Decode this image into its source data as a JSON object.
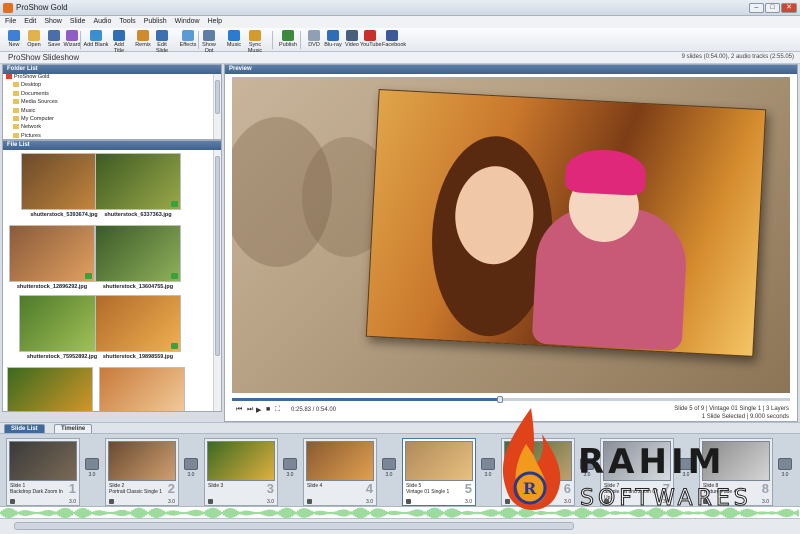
{
  "window": {
    "title": "ProShow Gold",
    "min": "–",
    "max": "□",
    "close": "✕"
  },
  "menu": [
    "File",
    "Edit",
    "Show",
    "Slide",
    "Audio",
    "Tools",
    "Publish",
    "Window",
    "Help"
  ],
  "toolbar": [
    {
      "label": "New",
      "icon": "new-icon",
      "color": "#3c7fd6"
    },
    {
      "label": "Open",
      "icon": "open-folder-icon",
      "color": "#e2b24a"
    },
    {
      "label": "Save",
      "icon": "save-icon",
      "color": "#4a6fa8"
    },
    {
      "label": "Wizard",
      "icon": "wizard-icon",
      "color": "#8e5ec4"
    },
    {
      "label": "Add Blank",
      "icon": "add-blank-icon",
      "color": "#3a8fd0"
    },
    {
      "label": "Add Title",
      "icon": "add-title-icon",
      "color": "#2f6db5"
    },
    {
      "label": "Remix",
      "icon": "remix-icon",
      "color": "#d08a2a"
    },
    {
      "label": "Edit Slide",
      "icon": "edit-slide-icon",
      "color": "#3b6fb0"
    },
    {
      "label": "Effects",
      "icon": "effects-icon",
      "color": "#5a9ad6"
    },
    {
      "label": "Show Opt",
      "icon": "show-options-icon",
      "color": "#5f7ea5"
    },
    {
      "label": "Music",
      "icon": "music-icon",
      "color": "#2b7bd3"
    },
    {
      "label": "Sync Music",
      "icon": "sync-music-icon",
      "color": "#d59a2c"
    },
    {
      "label": "Publish",
      "icon": "publish-icon",
      "color": "#3d8a3d"
    },
    {
      "label": "DVD",
      "icon": "dvd-icon",
      "color": "#8fa0b5"
    },
    {
      "label": "Blu-ray",
      "icon": "blu-ray-icon",
      "color": "#2c6fb8"
    },
    {
      "label": "Video",
      "icon": "video-icon",
      "color": "#4a5f7a"
    },
    {
      "label": "YouTube",
      "icon": "youtube-icon",
      "color": "#c8302a"
    },
    {
      "label": "Facebook",
      "icon": "facebook-icon",
      "color": "#3b5998"
    }
  ],
  "appbar": {
    "title": "ProShow Slideshow",
    "status": "9 slides (0:54.00), 2 audio tracks (2:55.05)"
  },
  "folder_list": {
    "header": "Folder List",
    "items": [
      "ProShow Gold",
      "Desktop",
      "Documents",
      "Media Sources",
      "Music",
      "My Computer",
      "Network",
      "Pictures"
    ]
  },
  "file_list": {
    "header": "File List",
    "files": [
      {
        "name": "shutterstock_5393674.jpg",
        "colors": [
          "#6b4a2a",
          "#c98a3f"
        ]
      },
      {
        "name": "shutterstock_6337363.jpg",
        "colors": [
          "#3d5a22",
          "#9aa84a"
        ]
      },
      {
        "name": "shutterstock_12896292.jpg",
        "colors": [
          "#8a5a3a",
          "#e0a060"
        ]
      },
      {
        "name": "shutterstock_13604755.jpg",
        "colors": [
          "#3a5a28",
          "#8fb05a"
        ]
      },
      {
        "name": "shutterstock_75952892.jpg",
        "colors": [
          "#4e7a2a",
          "#a7c55a"
        ]
      },
      {
        "name": "shutterstock_19898559.jpg",
        "colors": [
          "#b06a2a",
          "#f0b050"
        ]
      },
      {
        "name": "",
        "colors": [
          "#3a6a1e",
          "#e09a2a"
        ]
      },
      {
        "name": "",
        "colors": [
          "#c87a3a",
          "#f5d0a0"
        ]
      }
    ]
  },
  "preview": {
    "header": "Preview",
    "progress": 0.48,
    "timecode": "0:25.83 / 0:54.00",
    "slide_info": "Slide 5 of 9  |  Vintage 01 Single 1  |  3 Layers",
    "slide_info2": "1 Slide Selected  |  9.000 seconds",
    "controls": [
      "⏮",
      "⏭",
      "▶",
      "■",
      "⛶"
    ]
  },
  "tabs": [
    "Slide List",
    "Timeline"
  ],
  "slides": [
    {
      "label": "Slide 1",
      "sub": "Backdrop Dark Zoom In",
      "num": "1",
      "dur": "3.0",
      "colors": [
        "#3a3a3a",
        "#7a6a55"
      ]
    },
    {
      "label": "Slide 2",
      "sub": "Portrait Classic Single 1",
      "num": "2",
      "dur": "3.0",
      "colors": [
        "#6a4a30",
        "#d0a070"
      ]
    },
    {
      "label": "Slide 3",
      "sub": "",
      "num": "3",
      "dur": "3.0",
      "colors": [
        "#3c6a20",
        "#e0b040"
      ]
    },
    {
      "label": "Slide 4",
      "sub": "",
      "num": "4",
      "dur": "3.0",
      "colors": [
        "#8a5a30",
        "#e0a050"
      ]
    },
    {
      "label": "Slide 5",
      "sub": "Vintage 01 Single 1",
      "num": "5",
      "dur": "3.0",
      "colors": [
        "#b08a5a",
        "#e8c080"
      ]
    },
    {
      "label": "Slide 6",
      "sub": "",
      "num": "6",
      "dur": "3.0",
      "colors": [
        "#4a6a3a",
        "#c0a070"
      ]
    },
    {
      "label": "Slide 7",
      "sub": "Simple Tilt and Zoom 02 Up...",
      "num": "7",
      "dur": "3.0",
      "colors": [
        "#8a8f98",
        "#d8dce2"
      ]
    },
    {
      "label": "Slide 8",
      "sub": "Texture Fade 4",
      "num": "8",
      "dur": "3.0",
      "colors": [
        "#8a8a8a",
        "#d5d5d5"
      ]
    }
  ],
  "transition_dur": "3.0",
  "watermark": {
    "line1": "RAHIM",
    "line2": "SOFTWARES"
  }
}
